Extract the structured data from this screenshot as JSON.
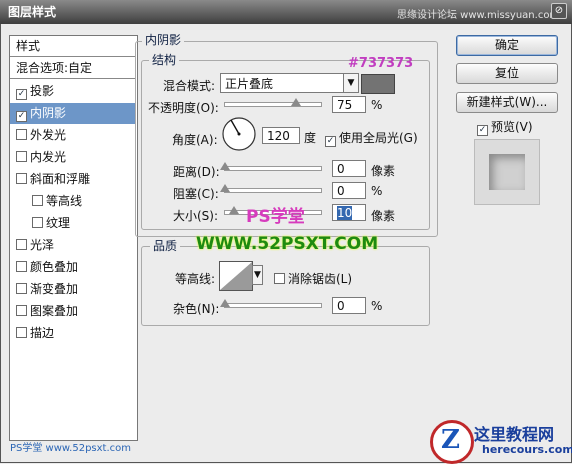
{
  "window": {
    "title": "图层样式",
    "watermark_top": "思缘设计论坛  www.missyuan.com"
  },
  "left_panel": {
    "header": "样式",
    "blend_options": "混合选项:自定",
    "items": [
      {
        "label": "投影",
        "checked": true
      },
      {
        "label": "内阴影",
        "checked": true,
        "selected": true
      },
      {
        "label": "外发光",
        "checked": false
      },
      {
        "label": "内发光",
        "checked": false
      },
      {
        "label": "斜面和浮雕",
        "checked": false
      },
      {
        "label": "等高线",
        "checked": false,
        "indent": true
      },
      {
        "label": "纹理",
        "checked": false,
        "indent": true
      },
      {
        "label": "光泽",
        "checked": false
      },
      {
        "label": "颜色叠加",
        "checked": false
      },
      {
        "label": "渐变叠加",
        "checked": false
      },
      {
        "label": "图案叠加",
        "checked": false
      },
      {
        "label": "描边",
        "checked": false
      }
    ],
    "checkmark": "✓"
  },
  "inner_shadow": {
    "section_title": "内阴影",
    "structure_title": "结构",
    "color_hex_label": "#737373",
    "color": "#737373",
    "blend_mode_label": "混合模式:",
    "blend_mode_value": "正片叠底",
    "opacity_label": "不透明度(O):",
    "opacity_value": "75",
    "opacity_unit": "%",
    "opacity_fraction": 0.75,
    "angle_label": "角度(A):",
    "angle_value": "120",
    "angle_unit": "度",
    "global_light_label": "使用全局光(G)",
    "global_light_checked": true,
    "distance_label": "距离(D):",
    "distance_value": "0",
    "distance_unit": "像素",
    "choke_label": "阻塞(C):",
    "choke_value": "0",
    "choke_unit": "%",
    "size_label": "大小(S):",
    "size_value": "10",
    "size_unit": "像素"
  },
  "quality": {
    "title": "品质",
    "contour_label": "等高线:",
    "anti_alias_label": "消除锯齿(L)",
    "anti_alias_checked": false,
    "noise_label": "杂色(N):",
    "noise_value": "0",
    "noise_unit": "%"
  },
  "buttons": {
    "ok": "确定",
    "reset": "复位",
    "new_style": "新建样式(W)...",
    "preview_label": "预览(V)",
    "preview_checked": true
  },
  "watermarks": {
    "ps_center": "PS学堂",
    "site_center": "WWW.52PSXT.COM",
    "bottom_left": "PS学堂 www.52psxt.com",
    "bottom_right_title": "这里教程网",
    "bottom_right_url": "herecours.com"
  }
}
